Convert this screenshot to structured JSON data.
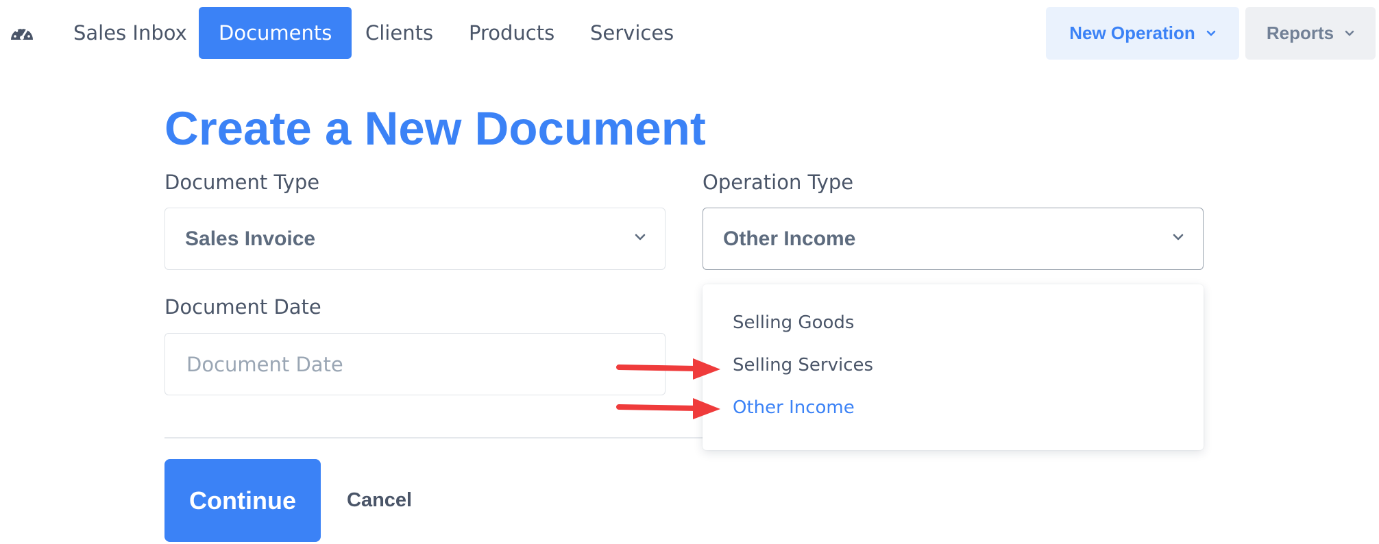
{
  "nav": {
    "items": [
      {
        "label": "Sales Inbox",
        "active": false
      },
      {
        "label": "Documents",
        "active": true
      },
      {
        "label": "Clients",
        "active": false
      },
      {
        "label": "Products",
        "active": false
      },
      {
        "label": "Services",
        "active": false
      }
    ],
    "new_operation_label": "New Operation",
    "reports_label": "Reports"
  },
  "page": {
    "title": "Create a New Document"
  },
  "form": {
    "document_type": {
      "label": "Document Type",
      "value": "Sales Invoice"
    },
    "operation_type": {
      "label": "Operation Type",
      "value": "Other Income",
      "options": [
        "Selling Goods",
        "Selling Services",
        "Other Income"
      ],
      "selected_index": 2
    },
    "document_date": {
      "label": "Document Date",
      "placeholder": "Document Date",
      "value": ""
    }
  },
  "actions": {
    "continue_label": "Continue",
    "cancel_label": "Cancel"
  },
  "colors": {
    "primary": "#3b82f6",
    "text": "#4a5568",
    "annotation_arrow": "#ef3b3b"
  }
}
